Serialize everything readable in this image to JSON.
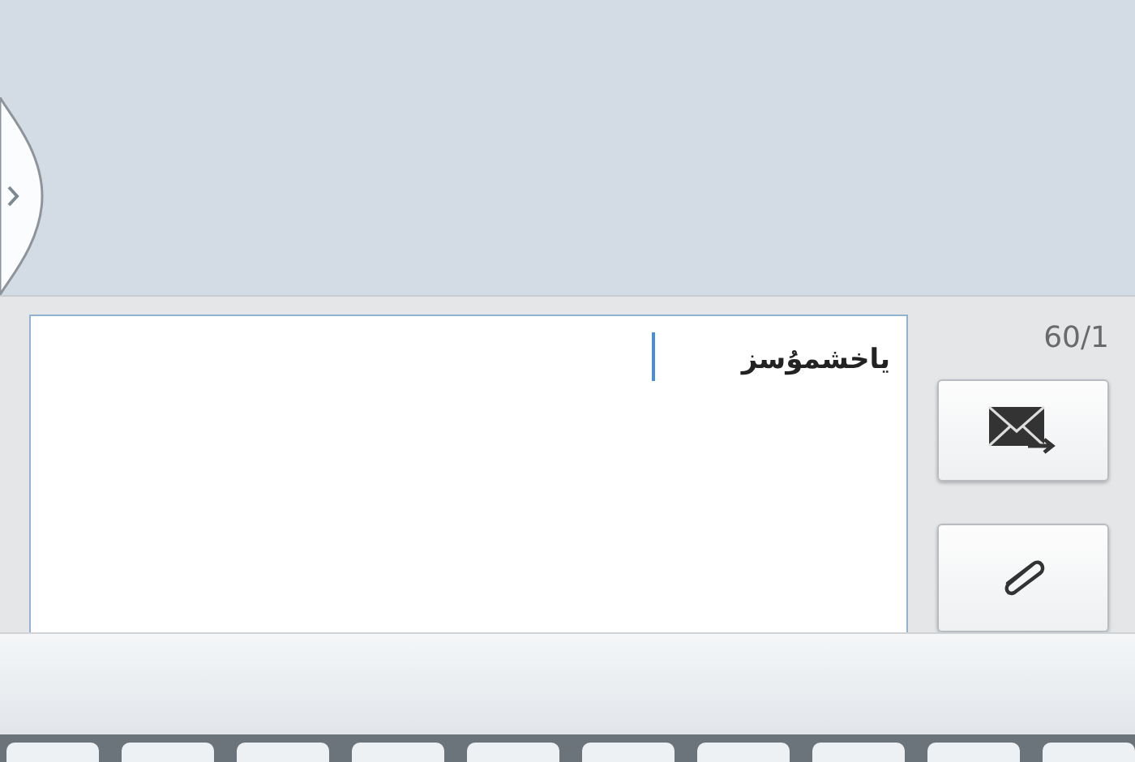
{
  "message_input": {
    "value": "ياخشمۇسز"
  },
  "counter": "60/1"
}
